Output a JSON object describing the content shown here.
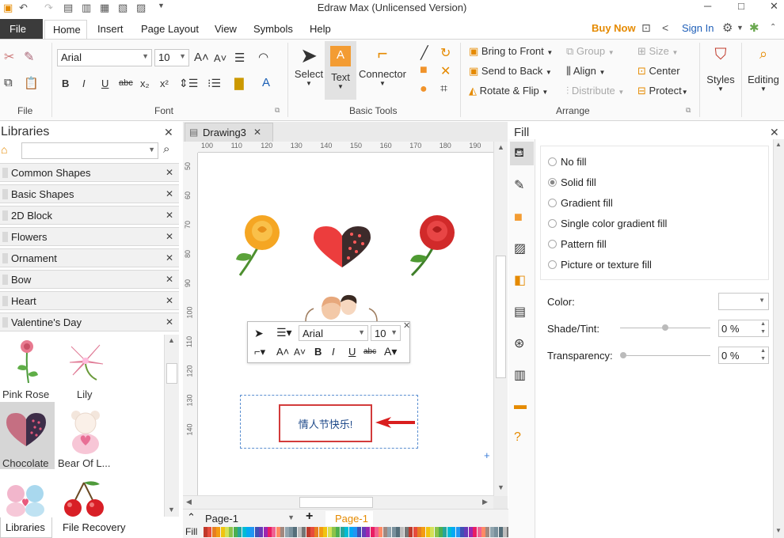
{
  "app": {
    "title": "Edraw Max (Unlicensed Version)"
  },
  "menu": {
    "file": "File",
    "tabs": [
      "Home",
      "Insert",
      "Page Layout",
      "View",
      "Symbols",
      "Help"
    ],
    "buy_now": "Buy Now",
    "sign_in": "Sign In"
  },
  "ribbon": {
    "font_name": "Arial",
    "font_size": "10",
    "groups": {
      "file": "File",
      "font": "Font",
      "basic_tools": "Basic Tools",
      "arrange": "Arrange"
    },
    "tools": {
      "select": "Select",
      "text": "Text",
      "connector": "Connector"
    },
    "arrange": {
      "bring_front": "Bring to Front",
      "send_back": "Send to Back",
      "rotate_flip": "Rotate & Flip",
      "group": "Group",
      "align": "Align",
      "distribute": "Distribute",
      "size": "Size",
      "center": "Center",
      "protect": "Protect"
    },
    "styles": "Styles",
    "editing": "Editing"
  },
  "libraries": {
    "title": "Libraries",
    "categories": [
      "Common Shapes",
      "Basic Shapes",
      "2D Block",
      "Flowers",
      "Ornament",
      "Bow",
      "Heart",
      "Valentine's Day"
    ],
    "thumbs": [
      "Pink Rose",
      "Lily",
      "Chocolate",
      "Bear Of L..."
    ],
    "bottom_tabs": [
      "Libraries",
      "File Recovery"
    ]
  },
  "document": {
    "tab": "Drawing3",
    "ruler_h": [
      "100",
      "110",
      "120",
      "130",
      "140",
      "150",
      "160",
      "170",
      "180",
      "190"
    ],
    "ruler_v": [
      "50",
      "60",
      "70",
      "80",
      "90",
      "100",
      "110",
      "120",
      "130",
      "140"
    ],
    "greeting": "情人节快乐!",
    "float_font": "Arial",
    "float_size": "10",
    "page_selector": "Page-1",
    "page_tab": "Page-1",
    "fill_label": "Fill"
  },
  "fill_panel": {
    "title": "Fill",
    "options": [
      "No fill",
      "Solid fill",
      "Gradient fill",
      "Single color gradient fill",
      "Pattern fill",
      "Picture or texture fill"
    ],
    "selected_index": 1,
    "color_label": "Color:",
    "shade_label": "Shade/Tint:",
    "shade_value": "0 %",
    "transparency_label": "Transparency:",
    "transparency_value": "0 %"
  },
  "colors": {
    "accent_orange": "#e58a00",
    "selection_red": "#d23b3b",
    "link_blue": "#1f5fb8"
  }
}
